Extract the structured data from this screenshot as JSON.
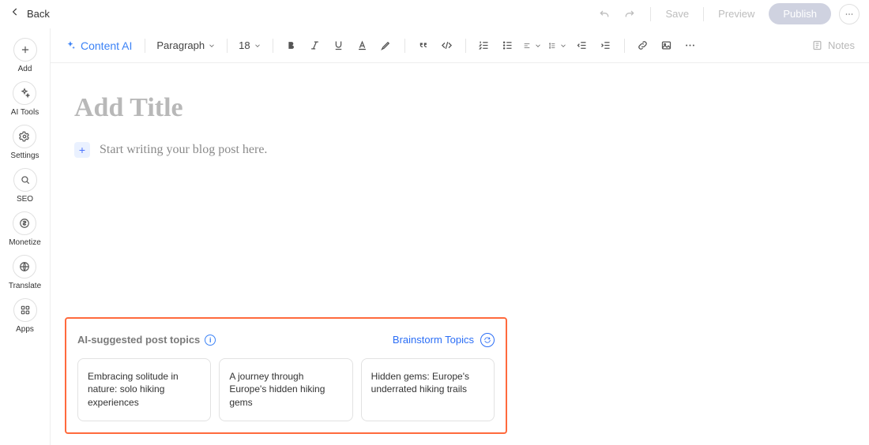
{
  "top": {
    "back": "Back",
    "save": "Save",
    "preview": "Preview",
    "publish": "Publish"
  },
  "sidebar": {
    "items": [
      {
        "label": "Add"
      },
      {
        "label": "AI Tools"
      },
      {
        "label": "Settings"
      },
      {
        "label": "SEO"
      },
      {
        "label": "Monetize"
      },
      {
        "label": "Translate"
      },
      {
        "label": "Apps"
      }
    ]
  },
  "toolbar": {
    "content_ai": "Content AI",
    "style_select": "Paragraph",
    "font_size": "18",
    "notes": "Notes"
  },
  "editor": {
    "title_placeholder": "Add Title",
    "body_placeholder": "Start writing your blog post here."
  },
  "ai_panel": {
    "heading": "AI-suggested post topics",
    "brainstorm": "Brainstorm Topics",
    "topics": [
      "Embracing solitude in nature: solo hiking experiences",
      "A journey through Europe's hidden hiking gems",
      "Hidden gems: Europe's underrated hiking trails"
    ]
  }
}
